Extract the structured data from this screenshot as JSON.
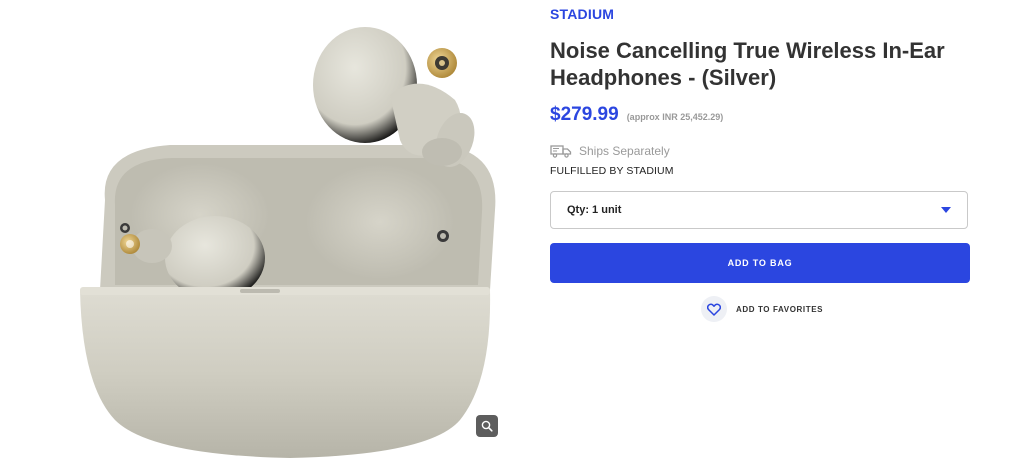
{
  "product": {
    "brand": "STADIUM",
    "title": "Noise Cancelling True Wireless In-Ear Headphones - (Silver)",
    "price": "$279.99",
    "approx_price": "(approx INR 25,452.29)",
    "shipping": "Ships Separately",
    "fulfilled_by": "FULFILLED BY STADIUM"
  },
  "purchase": {
    "quantity_label": "Qty: 1 unit",
    "add_to_bag": "ADD TO BAG",
    "add_to_favorites": "ADD TO FAVORITES"
  },
  "icons": {
    "zoom": "magnifier-icon",
    "shipping": "truck-icon",
    "dropdown": "caret-down-icon",
    "favorite": "heart-icon"
  },
  "colors": {
    "accent": "#2b46e0",
    "muted_text": "#9a9a9a",
    "product_silver": "#d3d2c6",
    "gold_accent": "#c9a45a"
  }
}
